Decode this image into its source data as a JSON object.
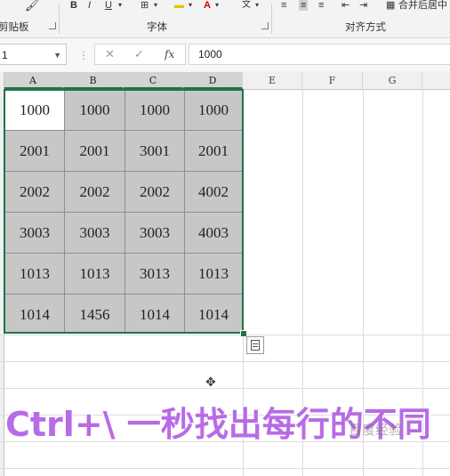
{
  "ribbon": {
    "groups": {
      "clipboard": "剪贴板",
      "font": "字体",
      "alignment": "对齐方式"
    },
    "tools": {
      "bold": "B",
      "italic": "I",
      "underline": "U",
      "merge_center": "合并后居中"
    },
    "icons": {
      "format_painter": "paintbrush-icon",
      "borders": "borders-icon",
      "fill_color": "fill-color-icon",
      "font_color": "font-color-icon",
      "phonetic": "phonetic-icon",
      "align_left": "align-left-icon",
      "align_center": "align-center-icon",
      "align_right": "align-right-icon",
      "indent": "indent-icon",
      "merge": "merge-icon"
    }
  },
  "formula_bar": {
    "name_box": "1",
    "cancel_glyph": "✕",
    "enter_glyph": "✓",
    "fx_glyph": "fx",
    "value": "1000"
  },
  "columns": [
    "A",
    "B",
    "C",
    "D",
    "E",
    "F",
    "G"
  ],
  "table": [
    [
      "1000",
      "1000",
      "1000",
      "1000"
    ],
    [
      "2001",
      "2001",
      "3001",
      "2001"
    ],
    [
      "2002",
      "2002",
      "2002",
      "4002"
    ],
    [
      "3003",
      "3003",
      "3003",
      "4003"
    ],
    [
      "1013",
      "1013",
      "3013",
      "1013"
    ],
    [
      "1014",
      "1456",
      "1014",
      "1014"
    ]
  ],
  "overlay": {
    "caption": "Ctrl+\\ 一秒找出每行的不同",
    "watermark": "百度经验"
  },
  "colors": {
    "selection": "#217346",
    "selected_fill": "#c7c7c7",
    "caption": "#b86be6"
  }
}
